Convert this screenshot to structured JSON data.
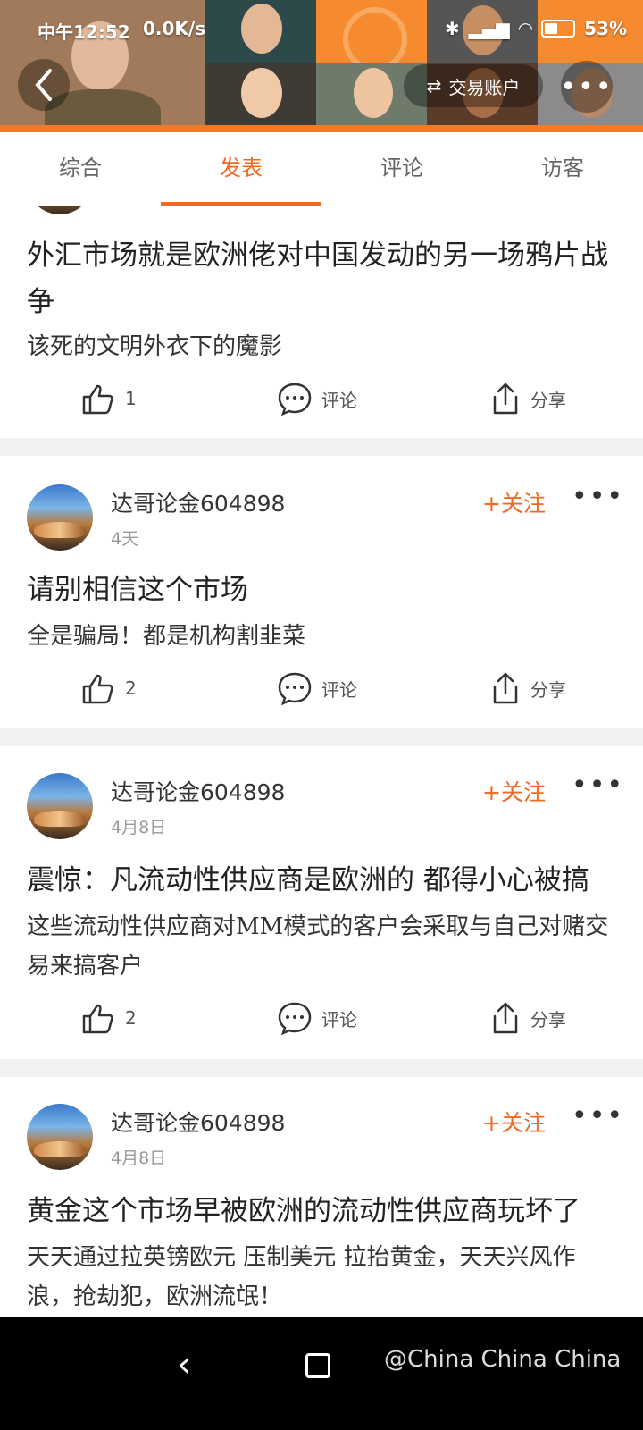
{
  "status": {
    "time": "中午12:52",
    "network": "0.0K/s",
    "battery": "53%"
  },
  "header": {
    "trade_account": "交易账户"
  },
  "tabs": [
    {
      "label": "综合"
    },
    {
      "label": "发表"
    },
    {
      "label": "评论"
    },
    {
      "label": "访客"
    }
  ],
  "active_tab": "发表",
  "posts": [
    {
      "title": "外汇市场就是欧洲佬对中国发动的另一场鸦片战争",
      "body": "该死的文明外衣下的魔影",
      "likes": "1",
      "comment_label": "评论",
      "share_label": "分享"
    },
    {
      "username": "达哥论金604898",
      "time": "4天",
      "follow": "+关注",
      "title": "请别相信这个市场",
      "body": "全是骗局！都是机构割韭菜",
      "likes": "2",
      "comment_label": "评论",
      "share_label": "分享"
    },
    {
      "username": "达哥论金604898",
      "time": "4月8日",
      "follow": "+关注",
      "title": "震惊：凡流动性供应商是欧洲的 都得小心被搞",
      "body": "这些流动性供应商对MM模式的客户会采取与自己对赌交易来搞客户",
      "likes": "2",
      "comment_label": "评论",
      "share_label": "分享"
    },
    {
      "username": "达哥论金604898",
      "time": "4月8日",
      "follow": "+关注",
      "title": "黄金这个市场早被欧洲的流动性供应商玩坏了",
      "body": "天天通过拉英镑欧元 压制美元 拉抬黄金，天天兴风作浪，抢劫犯，欧洲流氓！"
    }
  ],
  "watermark": "@China China China",
  "colors": {
    "accent": "#f06a22",
    "banner": "#f58a2f"
  }
}
